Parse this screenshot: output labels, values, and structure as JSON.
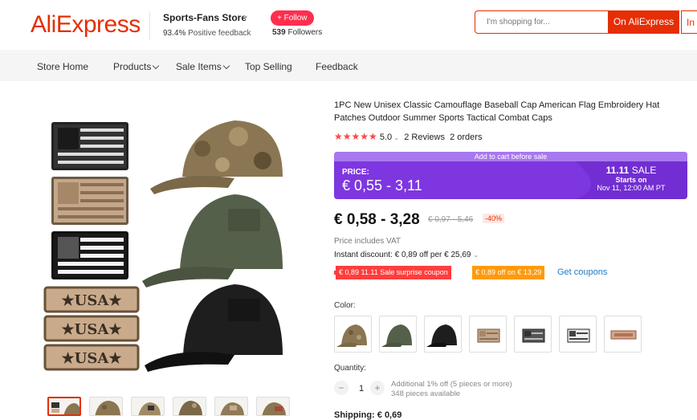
{
  "header": {
    "logo": "AliExpress",
    "store_name": "Sports-Fans Store",
    "feedback_pct": "93.4%",
    "feedback_text": "Positive feedback",
    "follow_label": "+ Follow",
    "followers_count": "539",
    "followers_label": "Followers",
    "search_placeholder": "I'm shopping for...",
    "search_btn": "On AliExpress",
    "search_btn2": "In"
  },
  "nav": {
    "items": [
      {
        "label": "Store Home"
      },
      {
        "label": "Products"
      },
      {
        "label": "Sale Items"
      },
      {
        "label": "Top Selling"
      },
      {
        "label": "Feedback"
      }
    ]
  },
  "product": {
    "title": "1PC New Unisex Classic Camouflage Baseball Cap American Flag Embroidery Hat Patches Outdoor Summer Sports Tactical Combat Caps",
    "rating": "5.0",
    "reviews": "2 Reviews",
    "orders": "2 orders",
    "sale_top": "Add to cart before sale",
    "price_label": "PRICE:",
    "sale_price": "€ 0,55 - 3,11",
    "sale_logo_num": "11.11",
    "sale_logo_word": "SALE",
    "sale_starts": "Starts on",
    "sale_date": "Nov 11, 12:00 AM PT",
    "current_price": "€ 0,58 - 3,28",
    "old_price": "€ 0,97 - 5,46",
    "discount": "-40%",
    "vat": "Price includes VAT",
    "instant_discount": "Instant discount: € 0,89 off per € 25,69",
    "coupon1": "€ 0,89 11.11 Sale surprise coupon",
    "coupon2": "€ 0,89 off on € 13,29",
    "get_coupons": "Get coupons",
    "color_label": "Color:",
    "quantity_label": "Quantity:",
    "quantity": "1",
    "qty_info1": "Additional 1% off (5 pieces or more)",
    "qty_info2": "348 pieces available",
    "shipping": "Shipping: € 0,69"
  },
  "colors": {
    "accent": "#e62e04",
    "sale_purple": "#7e37e0",
    "coupon_red": "#ff3d3d",
    "coupon_orange": "#ff9a0a",
    "link_blue": "#1a7cc9"
  }
}
